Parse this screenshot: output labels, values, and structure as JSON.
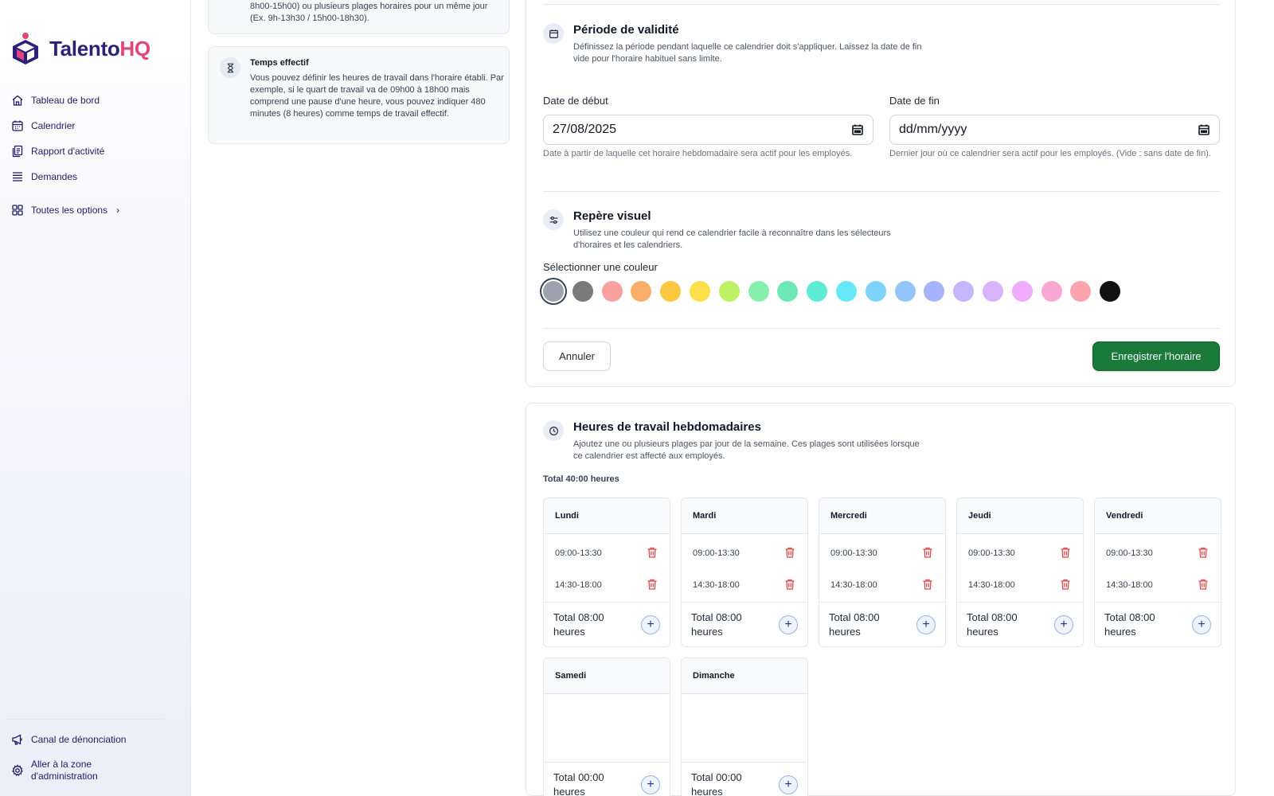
{
  "brand": {
    "name_part1": "Talento",
    "name_part2": "HQ"
  },
  "sidebar": {
    "items": [
      {
        "label": "Tableau de bord",
        "icon": "home-icon"
      },
      {
        "label": "Calendrier",
        "icon": "calendar-icon"
      },
      {
        "label": "Rapport d'activité",
        "icon": "report-icon"
      },
      {
        "label": "Demandes",
        "icon": "list-icon"
      }
    ],
    "more_label": "Toutes les options",
    "bottom": [
      {
        "label": "Canal de dénonciation",
        "icon": "megaphone-icon"
      },
      {
        "label": "Aller à la zone d'administration",
        "icon": "gear-icon"
      }
    ]
  },
  "info": {
    "top_text": "8h00-15h00) ou plusieurs plages horaires pour un même jour (Ex. 9h-13h30 / 15h00-18h30).",
    "effective_title": "Temps effectif",
    "effective_body": "Vous pouvez définir les heures de travail dans l'horaire établi. Par exemple, si le quart de travail va de 09h00 à 18h00 mais comprend une pause d'une heure, vous pouvez indiquer 480 minutes (8 heures) comme temps de travail effectif."
  },
  "validity": {
    "title": "Période de validité",
    "desc": "Définissez la période pendant laquelle ce calendrier doit s'appliquer. Laissez la date de fin vide pour l'horaire habituel sans limite.",
    "start_label": "Date de début",
    "start_value": "27/08/2025",
    "start_hint": "Date à partir de laquelle cet horaire hebdomadaire sera actif pour les employés.",
    "end_label": "Date de fin",
    "end_placeholder": "dd/mm/yyyy",
    "end_hint": "Dernier jour où ce calendrier sera actif pour les employés. (Vide : sans date de fin)."
  },
  "visual": {
    "title": "Repère visuel",
    "desc": "Utilisez une couleur qui rend ce calendrier facile à reconnaître dans les sélecteurs d'horaires et les calendriers.",
    "color_label": "Sélectionner une couleur",
    "selected_index": 0,
    "colors": [
      "#9ca3af",
      "#7a7a7a",
      "#f8a1a1",
      "#fbad6b",
      "#fbc93f",
      "#fde047",
      "#bef264",
      "#86efac",
      "#6ee7b7",
      "#5eead4",
      "#67e8f9",
      "#7dd3fc",
      "#93c5fd",
      "#a5b4fc",
      "#c4b5fd",
      "#d8b4fe",
      "#f0abfc",
      "#f9a8d4",
      "#fda4af",
      "#111111"
    ]
  },
  "actions": {
    "cancel": "Annuler",
    "save": "Enregistrer l'horaire"
  },
  "weekly": {
    "title": "Heures de travail hebdomadaires",
    "desc": "Ajoutez une ou plusieurs plages par jour de la semaine. Ces plages sont utilisées lorsque ce calendrier est affecté aux employés.",
    "total": "Total 40:00 heures",
    "days": [
      {
        "name": "Lundi",
        "slots": [
          "09:00-13:30",
          "14:30-18:00"
        ],
        "total": "Total 08:00 heures"
      },
      {
        "name": "Mardi",
        "slots": [
          "09:00-13:30",
          "14:30-18:00"
        ],
        "total": "Total 08:00 heures"
      },
      {
        "name": "Mercredi",
        "slots": [
          "09:00-13:30",
          "14:30-18:00"
        ],
        "total": "Total 08:00 heures"
      },
      {
        "name": "Jeudi",
        "slots": [
          "09:00-13:30",
          "14:30-18:00"
        ],
        "total": "Total 08:00 heures"
      },
      {
        "name": "Vendredi",
        "slots": [
          "09:00-13:30",
          "14:30-18:00"
        ],
        "total": "Total 08:00 heures"
      },
      {
        "name": "Samedi",
        "slots": [],
        "total": "Total 00:00 heures"
      },
      {
        "name": "Dimanche",
        "slots": [],
        "total": "Total 00:00 heures"
      }
    ],
    "add_symbol": "+"
  }
}
